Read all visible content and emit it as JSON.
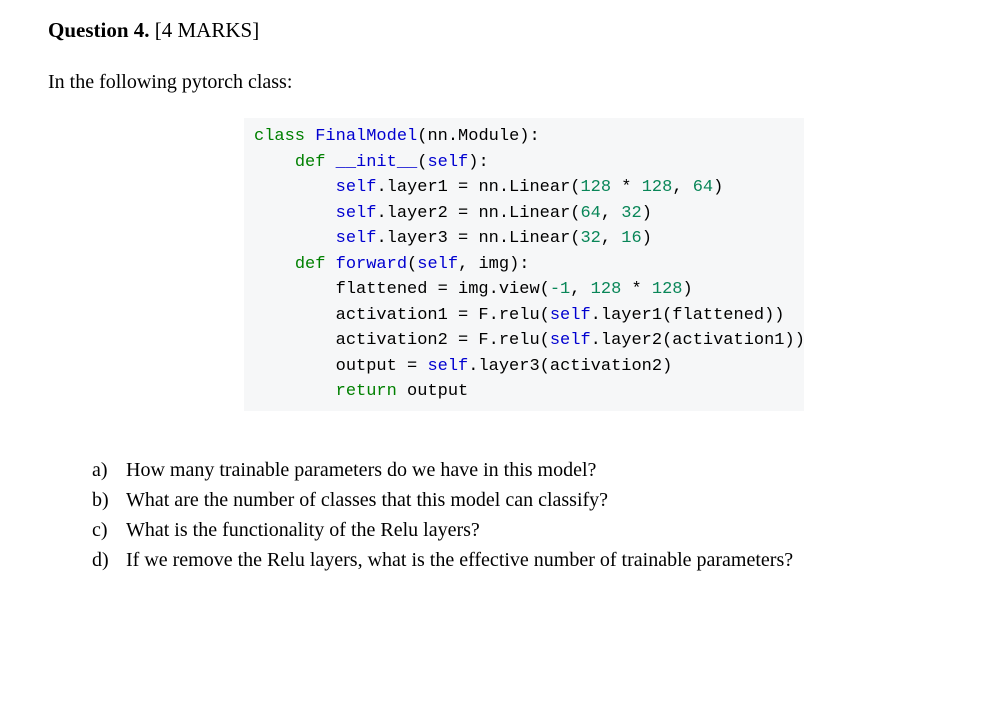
{
  "question_header": {
    "label": "Question 4.",
    "marks": "[4 MARKS]"
  },
  "intro_text": "In the following pytorch class:",
  "code": {
    "l1": {
      "t1": "class ",
      "t2": "FinalModel",
      "t3": "(nn.Module):"
    },
    "l2": {
      "t1": "    ",
      "t2": "def ",
      "t3": "__init__",
      "t4": "(",
      "t5": "self",
      "t6": "):"
    },
    "l3": {
      "t1": "        ",
      "t2": "self",
      "t3": ".layer1 = nn.Linear(",
      "n1": "128",
      "t4": " * ",
      "n2": "128",
      "t5": ", ",
      "n3": "64",
      "t6": ")"
    },
    "l4": {
      "t1": "        ",
      "t2": "self",
      "t3": ".layer2 = nn.Linear(",
      "n1": "64",
      "t4": ", ",
      "n2": "32",
      "t5": ")"
    },
    "l5": {
      "t1": "        ",
      "t2": "self",
      "t3": ".layer3 = nn.Linear(",
      "n1": "32",
      "t4": ", ",
      "n2": "16",
      "t5": ")"
    },
    "l6": {
      "t1": "    ",
      "t2": "def ",
      "t3": "forward",
      "t4": "(",
      "t5": "self",
      "t6": ", img):"
    },
    "l7": {
      "t1": "        flattened = img.view(",
      "n1": "-1",
      "t2": ", ",
      "n2": "128",
      "t3": " * ",
      "n3": "128",
      "t4": ")"
    },
    "l8": {
      "t1": "        activation1 = F.relu(",
      "t2": "self",
      "t3": ".layer1(flattened))"
    },
    "l9": {
      "t1": "        activation2 = F.relu(",
      "t2": "self",
      "t3": ".layer2(activation1))"
    },
    "l10": {
      "t1": "        output = ",
      "t2": "self",
      "t3": ".layer3(activation2)"
    },
    "l11": {
      "t1": "        ",
      "t2": "return ",
      "t3": "output"
    }
  },
  "subquestions": [
    {
      "marker": "a)",
      "text": "How many trainable parameters do we have in this model?"
    },
    {
      "marker": "b)",
      "text": "What are the number of classes that this model can classify?"
    },
    {
      "marker": "c)",
      "text": "What is the functionality of the Relu layers?"
    },
    {
      "marker": "d)",
      "text": "If we remove the Relu layers, what is the effective number of trainable parameters?"
    }
  ]
}
